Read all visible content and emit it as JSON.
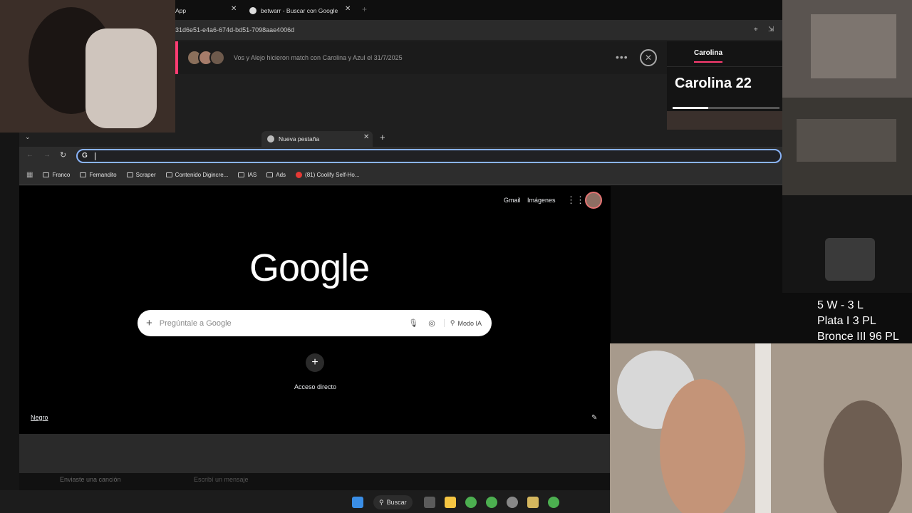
{
  "bg_browser": {
    "tab1_label": "App",
    "tab2_label": "betwarr - Buscar con Google",
    "url": "31d6e51-e4a6-674d-bd51-7098aae4006d",
    "match_text": "Vos y Alejo hicieron match con Carolina y Azul el 31/7/2025",
    "profile_tab": "Carolina",
    "profile_name": "Carolina 22"
  },
  "main_browser": {
    "tab_label": "Nueva pestaña",
    "bookmarks": [
      "Franco",
      "Fernandito",
      "Scraper",
      "Contenido Digincre...",
      "IAS",
      "Ads",
      "(81) Coolify Self-Ho..."
    ],
    "header_links": {
      "gmail": "Gmail",
      "images": "Imágenes"
    },
    "logo_text": "Google",
    "search_placeholder": "Pregúntale a Google",
    "ai_mode_label": "Modo IA",
    "shortcut_label": "Acceso directo",
    "theme_label": "Negro"
  },
  "bg_chat": {
    "song_text": "Enviaste una canción",
    "message_placeholder": "Escribí un mensaje"
  },
  "stats": {
    "line1": "5 W - 3 L",
    "line2": "Plata I 3 PL",
    "line3": "Bronce III 96 PL"
  },
  "taskbar": {
    "search_label": "Buscar"
  },
  "colors": {
    "accent_pink": "#fe3c72",
    "focus_blue": "#8ab4f8"
  }
}
